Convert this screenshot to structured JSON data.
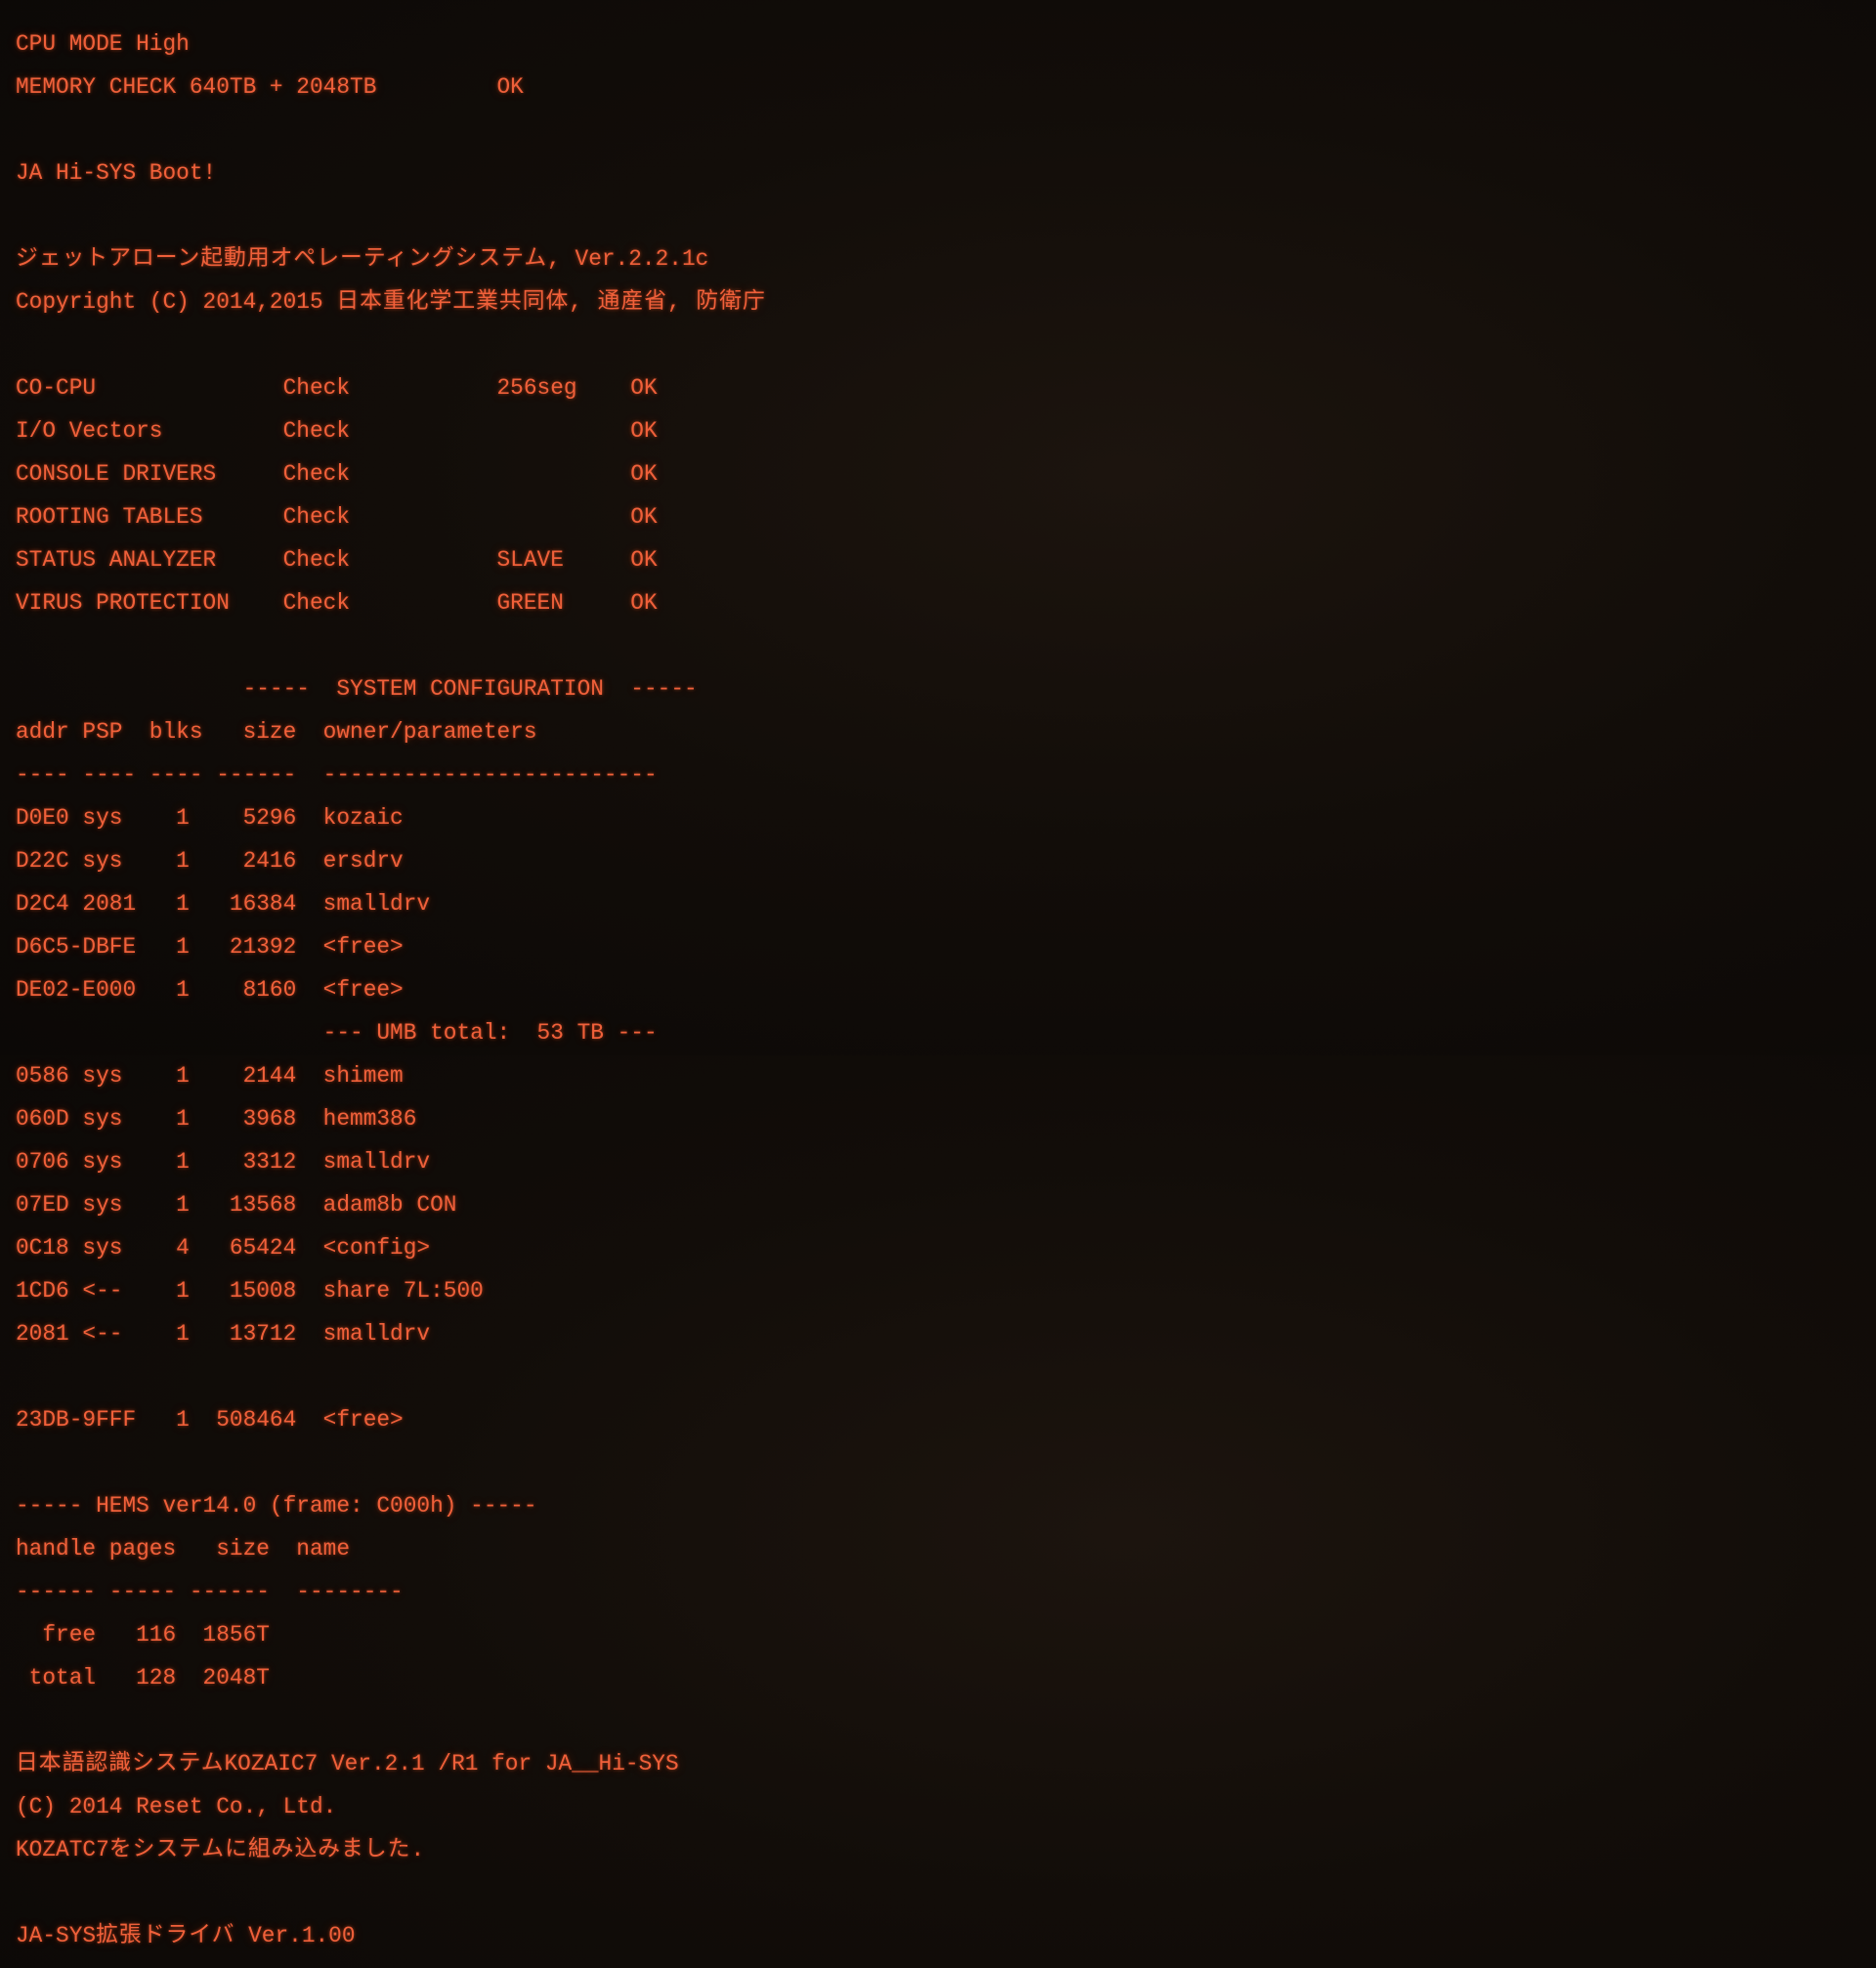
{
  "boot": {
    "cpu_mode": "CPU MODE High",
    "memory_check": "MEMORY CHECK 640TB + 2048TB         OK",
    "boot_message": "JA Hi-SYS Boot!",
    "os_title_jp": "ジェットアローン起動用オペレーティングシステム,",
    "os_version": " Ver.2.2.1c",
    "copyright_prefix": "Copyright (C) 2014,2015 ",
    "copyright_jp": "日本重化学工業共同体, 通産省, 防衛庁"
  },
  "checks": [
    "CO-CPU              Check           256seg    OK",
    "I/O Vectors         Check                     OK",
    "CONSOLE DRIVERS     Check                     OK",
    "ROOTING TABLES      Check                     OK",
    "STATUS ANALYZER     Check           SLAVE     OK",
    "VIRUS PROTECTION    Check           GREEN     OK"
  ],
  "sysconfig": {
    "header": "                 -----  SYSTEM CONFIGURATION  -----",
    "columns": "addr PSP  blks   size  owner/parameters",
    "separator": "---- ---- ---- ------  -------------------------",
    "rows": [
      "D0E0 sys    1    5296  kozaic",
      "D22C sys    1    2416  ersdrv",
      "D2C4 2081   1   16384  smalldrv",
      "D6C5-DBFE   1   21392  <free>",
      "DE02-E000   1    8160  <free>",
      "                       --- UMB total:  53 TB ---",
      "0586 sys    1    2144  shimem",
      "060D sys    1    3968  hemm386",
      "0706 sys    1    3312  smalldrv",
      "07ED sys    1   13568  adam8b CON",
      "0C18 sys    4   65424  <config>",
      "1CD6 <--    1   15008  share 7L:500",
      "2081 <--    1   13712  smalldrv"
    ],
    "free_row": "23DB-9FFF   1  508464  <free>"
  },
  "hems": {
    "header": "----- HEMS ver14.0 (frame: C000h) -----",
    "columns": "handle pages   size  name",
    "separator": "------ ----- ------  --------",
    "rows": [
      "  free   116  1856T",
      " total   128  2048T"
    ]
  },
  "kozaic": {
    "title_jp": "日本語認識システム",
    "title_rest": "KOZAIC7 Ver.2.1 /R1 for JA__Hi-SYS",
    "copyright": "(C) 2014 Reset Co., Ltd.",
    "installed_prefix": "KOZATC7",
    "installed_jp": "をシステムに組み込みました."
  },
  "driver": {
    "prefix": "JA-SYS",
    "name_jp": "拡張ドライバ",
    "version": " Ver.1.00"
  },
  "colors": {
    "text": "#f0603a",
    "background": "#120d09"
  }
}
